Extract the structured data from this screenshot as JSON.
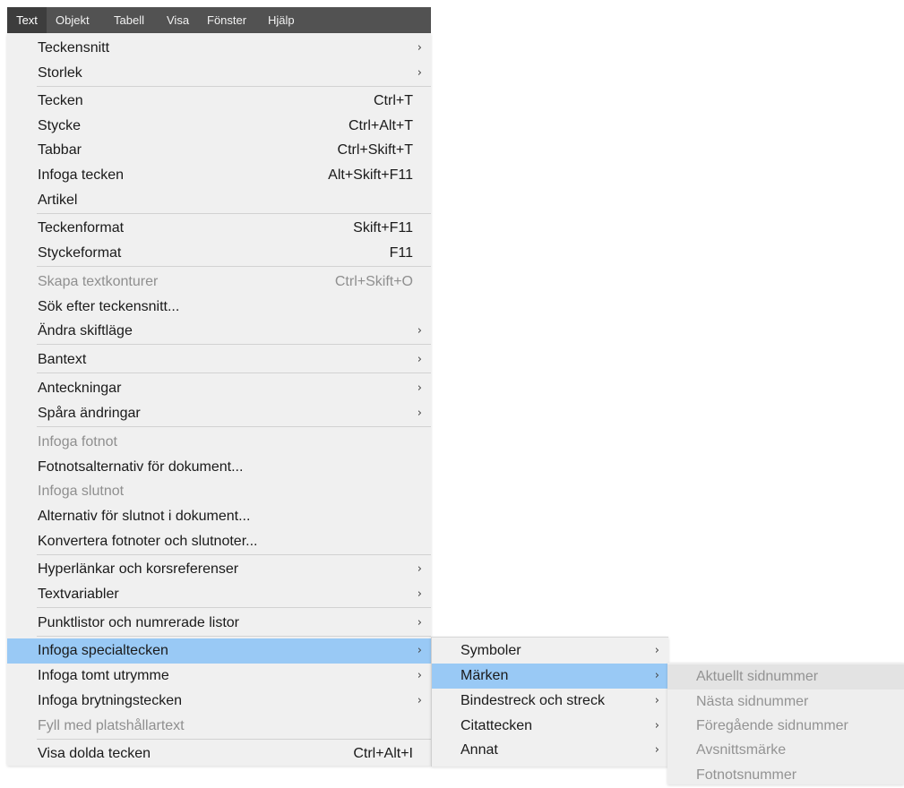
{
  "menubar": {
    "items": [
      {
        "label": "Text",
        "active": true
      },
      {
        "label": "Objekt"
      },
      {
        "label": "Tabell"
      },
      {
        "label": "Visa"
      },
      {
        "label": "Fönster"
      },
      {
        "label": "Hjälp"
      }
    ]
  },
  "text_menu": {
    "items": [
      {
        "label": "Teckensnitt",
        "submenu": true
      },
      {
        "label": "Storlek",
        "submenu": true
      },
      {
        "label": "Tecken",
        "shortcut": "Ctrl+T"
      },
      {
        "label": "Stycke",
        "shortcut": "Ctrl+Alt+T"
      },
      {
        "label": "Tabbar",
        "shortcut": "Ctrl+Skift+T"
      },
      {
        "label": "Infoga tecken",
        "shortcut": "Alt+Skift+F11"
      },
      {
        "label": "Artikel"
      },
      {
        "label": "Teckenformat",
        "shortcut": "Skift+F11"
      },
      {
        "label": "Styckeformat",
        "shortcut": "F11"
      },
      {
        "label": "Skapa textkonturer",
        "shortcut": "Ctrl+Skift+O",
        "disabled": true
      },
      {
        "label": "Sök efter teckensnitt..."
      },
      {
        "label": "Ändra skiftläge",
        "submenu": true
      },
      {
        "label": "Bantext",
        "submenu": true
      },
      {
        "label": "Anteckningar",
        "submenu": true
      },
      {
        "label": "Spåra ändringar",
        "submenu": true
      },
      {
        "label": "Infoga fotnot",
        "disabled": true
      },
      {
        "label": "Fotnotsalternativ för dokument..."
      },
      {
        "label": "Infoga slutnot",
        "disabled": true
      },
      {
        "label": "Alternativ för slutnot i dokument..."
      },
      {
        "label": "Konvertera fotnoter och slutnoter..."
      },
      {
        "label": "Hyperlänkar och korsreferenser",
        "submenu": true
      },
      {
        "label": "Textvariabler",
        "submenu": true
      },
      {
        "label": "Punktlistor och numrerade listor",
        "submenu": true
      },
      {
        "label": "Infoga specialtecken",
        "submenu": true,
        "highlighted": true
      },
      {
        "label": "Infoga tomt utrymme",
        "submenu": true
      },
      {
        "label": "Infoga brytningstecken",
        "submenu": true
      },
      {
        "label": "Fyll med platshållartext",
        "disabled": true
      },
      {
        "label": "Visa dolda tecken",
        "shortcut": "Ctrl+Alt+I"
      }
    ]
  },
  "special_chars_menu": {
    "items": [
      {
        "label": "Symboler",
        "submenu": true
      },
      {
        "label": "Märken",
        "submenu": true,
        "highlighted": true
      },
      {
        "label": "Bindestreck och streck",
        "submenu": true
      },
      {
        "label": "Citattecken",
        "submenu": true
      },
      {
        "label": "Annat",
        "submenu": true
      }
    ]
  },
  "markers_menu": {
    "items": [
      {
        "label": "Aktuellt sidnummer",
        "disabled": true
      },
      {
        "label": "Nästa sidnummer",
        "disabled": true
      },
      {
        "label": "Föregående sidnummer",
        "disabled": true
      },
      {
        "label": "Avsnittsmärke",
        "disabled": true
      },
      {
        "label": "Fotnotsnummer",
        "disabled": true
      }
    ]
  },
  "glyphs": {
    "submenu_arrow": "›"
  }
}
